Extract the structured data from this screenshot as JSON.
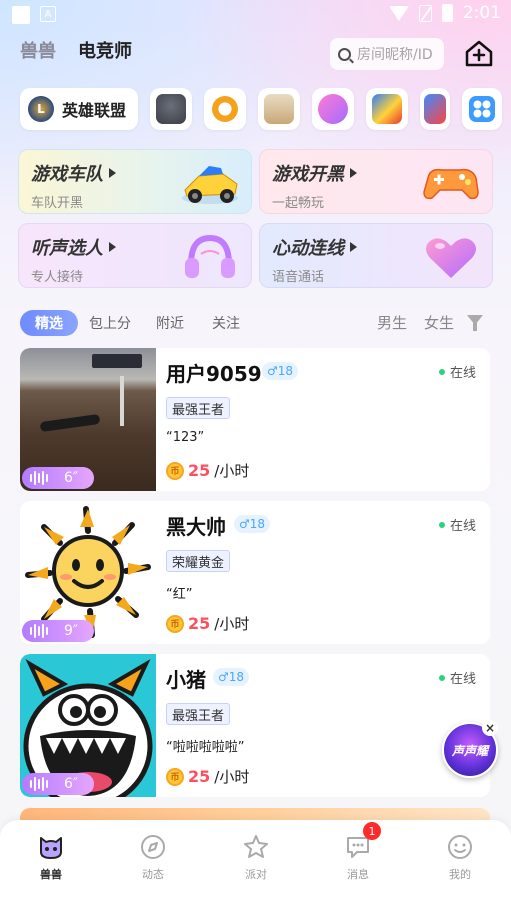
{
  "statusbar": {
    "time": "2:01"
  },
  "header": {
    "tabs": [
      "兽兽",
      "电竞师"
    ],
    "active_tab": "电竞师",
    "search_placeholder": "房间昵称/ID"
  },
  "games": {
    "selected_label": "英雄联盟",
    "icons": [
      "pubg-helmet-icon",
      "overwatch-icon",
      "event-banner-icon",
      "music-note-icon",
      "kart-game-icon",
      "runner-game-icon",
      "more-apps-icon"
    ]
  },
  "feature_cards": [
    {
      "title": "游戏车队",
      "subtitle": "车队开黑",
      "icon": "kart-car-icon"
    },
    {
      "title": "游戏开黑",
      "subtitle": "一起畅玩",
      "icon": "gamepad-icon"
    },
    {
      "title": "听声选人",
      "subtitle": "专人接待",
      "icon": "headphones-icon"
    },
    {
      "title": "心动连线",
      "subtitle": "语音通话",
      "icon": "heart-icon"
    }
  ],
  "filters": {
    "tabs": [
      "精选",
      "包上分",
      "附近",
      "关注"
    ],
    "active": "精选",
    "gender": [
      "男生",
      "女生"
    ]
  },
  "users": [
    {
      "name": "用户9059",
      "age": "♂18",
      "status": "在线",
      "rank": "最强王者",
      "quote": "“123”",
      "price": "25",
      "unit": "/小时",
      "voice": "6″",
      "photo": "desk-photo"
    },
    {
      "name": "黑大帅",
      "age": "♂18",
      "status": "在线",
      "rank": "荣耀黄金",
      "quote": "“红”",
      "price": "25",
      "unit": "/小时",
      "voice": "9″",
      "photo": "sun-drawing"
    },
    {
      "name": "小猪",
      "age": "♂18",
      "status": "在线",
      "rank": "最强王者",
      "quote": "“啦啦啦啦啦”",
      "price": "25",
      "unit": "/小时",
      "voice": "6″",
      "photo": "monster-avatar"
    }
  ],
  "float_badge": {
    "text": "声声耀",
    "close": "×"
  },
  "nav": {
    "items": [
      "兽兽",
      "动态",
      "派对",
      "消息",
      "我的"
    ],
    "active": "兽兽",
    "message_badge": "1"
  },
  "coin_glyph": "币",
  "colors": {
    "accent": "#6f8bff",
    "price": "#ff4f5e",
    "online": "#2bd37c",
    "badge": "#ff2a2a"
  }
}
